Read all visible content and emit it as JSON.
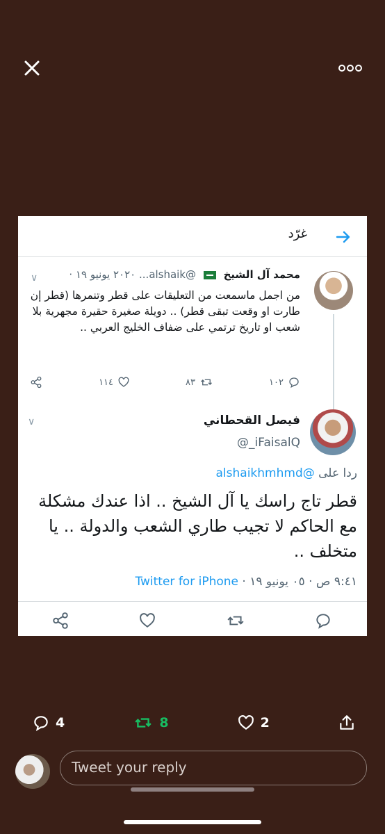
{
  "viewer": {
    "close_icon": "close-icon",
    "more_icon": "more-horizontal-icon"
  },
  "screenshot": {
    "header": {
      "title": "غرّد",
      "back_icon": "arrow-right-icon"
    },
    "original_tweet": {
      "name": "محمد آل الشيخ",
      "handle": "@alshaik...",
      "date": "٢٠٢٠ يونيو ١٩ ·",
      "body": "من اجمل ماسمعت من التعليقات على قطر وتنمرها (قطر إن طارت او وقعت تبقى قطر) .. دويلة صغيرة حقيرة مجهرية بلا شعب او تاريخ ترتمي على ضفاف الخليج العربي ..",
      "replies": "١٠٢",
      "retweets": "٨٣",
      "likes": "١١٤"
    },
    "reply_tweet": {
      "name": "فيصل القحطاني",
      "handle": "@_iFaisalQ",
      "replying_label": "ردا على",
      "replying_to": "@alshaikhmhmd",
      "body": "قطر تاج راسك يا آل الشيخ .. اذا عندك مشكلة مع الحاكم لا تجيب طاري الشعب والدولة .. يا متخلف ..",
      "timestamp": "٩:٤١ ص · ٠٥ يونيو ١٩ ·",
      "client": "Twitter for iPhone"
    }
  },
  "bottom_bar": {
    "replies": "4",
    "retweets": "8",
    "likes": "2",
    "reply_placeholder": "Tweet your reply"
  },
  "colors": {
    "background": "#3a1f17",
    "accent_blue": "#1d9bf0",
    "retweet_green": "#17bf63"
  }
}
